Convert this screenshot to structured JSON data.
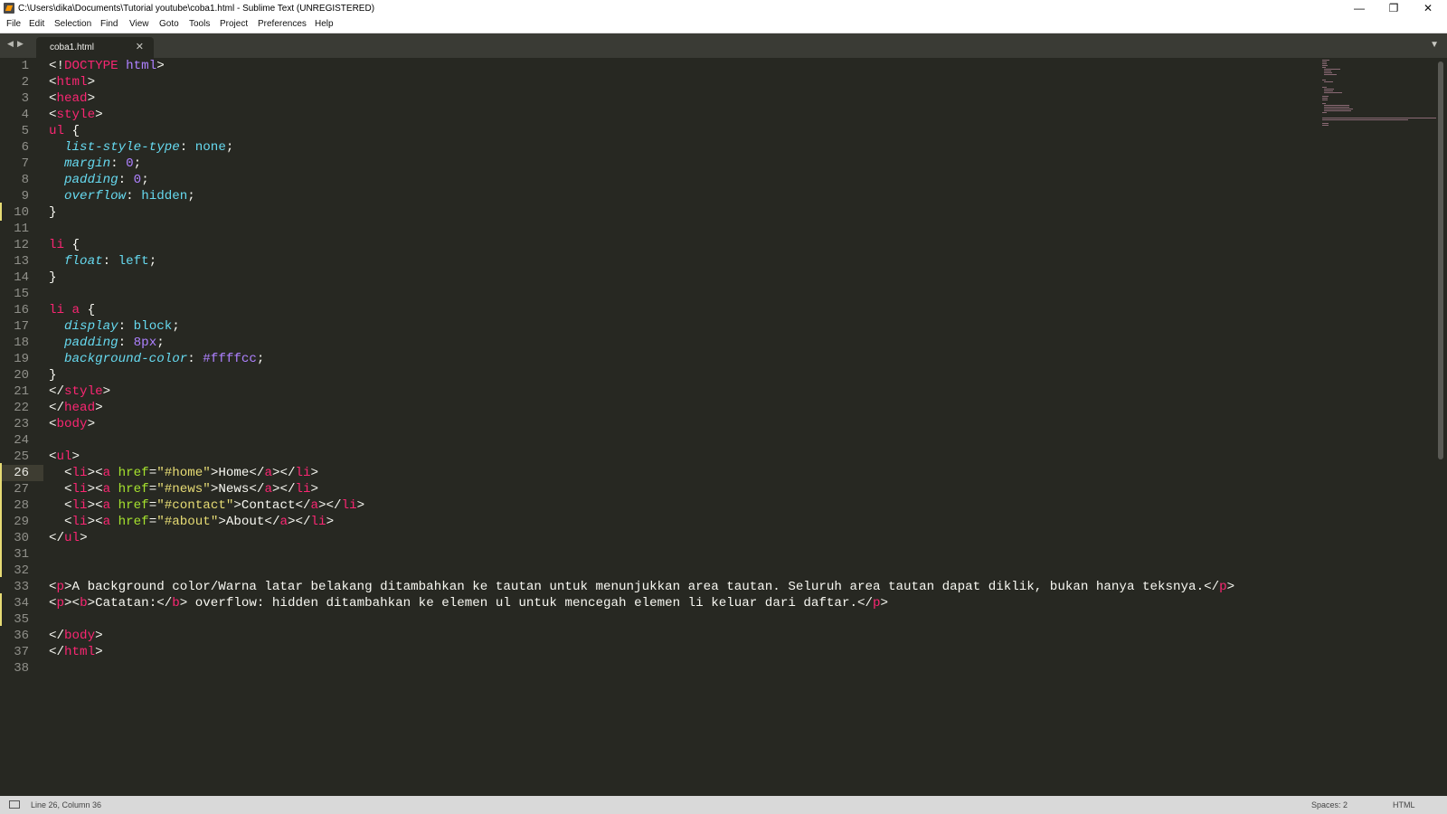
{
  "window": {
    "title": "C:\\Users\\dika\\Documents\\Tutorial youtube\\coba1.html - Sublime Text (UNREGISTERED)",
    "minimize_glyph": "—",
    "restore_glyph": "❐",
    "close_glyph": "✕"
  },
  "menu": [
    "File",
    "Edit",
    "Selection",
    "Find",
    "View",
    "Goto",
    "Tools",
    "Project",
    "Preferences",
    "Help"
  ],
  "tabs": {
    "back_glyph": "◀",
    "forward_glyph": "▶",
    "active_tab": "coba1.html",
    "close_glyph": "✕",
    "dropdown_glyph": "▼"
  },
  "editor": {
    "current_line": 26,
    "line_numbers": [
      "1",
      "2",
      "3",
      "4",
      "5",
      "6",
      "7",
      "8",
      "9",
      "10",
      "11",
      "12",
      "13",
      "14",
      "15",
      "16",
      "17",
      "18",
      "19",
      "20",
      "21",
      "22",
      "23",
      "24",
      "25",
      "26",
      "27",
      "28",
      "29",
      "30",
      "31",
      "32",
      "33",
      "34",
      "35",
      "36",
      "37",
      "38"
    ],
    "lines": [
      [
        [
          "p",
          "<!"
        ],
        [
          "doctype",
          "DOCTYPE"
        ],
        [
          "p",
          " "
        ],
        [
          "dtval",
          "html"
        ],
        [
          "p",
          ">"
        ]
      ],
      [
        [
          "p",
          "<"
        ],
        [
          "tag",
          "html"
        ],
        [
          "p",
          ">"
        ]
      ],
      [
        [
          "p",
          "<"
        ],
        [
          "tag",
          "head"
        ],
        [
          "p",
          ">"
        ]
      ],
      [
        [
          "p",
          "<"
        ],
        [
          "tag",
          "style"
        ],
        [
          "p",
          ">"
        ]
      ],
      [
        [
          "tag",
          "ul"
        ],
        [
          "p",
          " {"
        ]
      ],
      [
        [
          "p",
          "  "
        ],
        [
          "prop",
          "list-style-type"
        ],
        [
          "p",
          ": "
        ],
        [
          "sup",
          "none"
        ],
        [
          "p",
          ";"
        ]
      ],
      [
        [
          "p",
          "  "
        ],
        [
          "prop",
          "margin"
        ],
        [
          "p",
          ": "
        ],
        [
          "num",
          "0"
        ],
        [
          "p",
          ";"
        ]
      ],
      [
        [
          "p",
          "  "
        ],
        [
          "prop",
          "padding"
        ],
        [
          "p",
          ": "
        ],
        [
          "num",
          "0"
        ],
        [
          "p",
          ";"
        ]
      ],
      [
        [
          "p",
          "  "
        ],
        [
          "prop",
          "overflow"
        ],
        [
          "p",
          ": "
        ],
        [
          "sup",
          "hidden"
        ],
        [
          "p",
          ";"
        ]
      ],
      [
        [
          "p",
          "}"
        ]
      ],
      [],
      [
        [
          "tag",
          "li"
        ],
        [
          "p",
          " {"
        ]
      ],
      [
        [
          "p",
          "  "
        ],
        [
          "prop",
          "float"
        ],
        [
          "p",
          ": "
        ],
        [
          "sup",
          "left"
        ],
        [
          "p",
          ";"
        ]
      ],
      [
        [
          "p",
          "}"
        ]
      ],
      [],
      [
        [
          "tag",
          "li a"
        ],
        [
          "p",
          " {"
        ]
      ],
      [
        [
          "p",
          "  "
        ],
        [
          "prop",
          "display"
        ],
        [
          "p",
          ": "
        ],
        [
          "sup",
          "block"
        ],
        [
          "p",
          ";"
        ]
      ],
      [
        [
          "p",
          "  "
        ],
        [
          "prop",
          "padding"
        ],
        [
          "p",
          ": "
        ],
        [
          "num",
          "8px"
        ],
        [
          "p",
          ";"
        ]
      ],
      [
        [
          "p",
          "  "
        ],
        [
          "prop",
          "background-color"
        ],
        [
          "p",
          ": "
        ],
        [
          "num",
          "#ffffcc"
        ],
        [
          "p",
          ";"
        ]
      ],
      [
        [
          "p",
          "}"
        ]
      ],
      [
        [
          "p",
          "</"
        ],
        [
          "tag",
          "style"
        ],
        [
          "p",
          ">"
        ]
      ],
      [
        [
          "p",
          "</"
        ],
        [
          "tag",
          "head"
        ],
        [
          "p",
          ">"
        ]
      ],
      [
        [
          "p",
          "<"
        ],
        [
          "tag",
          "body"
        ],
        [
          "p",
          ">"
        ]
      ],
      [],
      [
        [
          "p",
          "<"
        ],
        [
          "tag",
          "ul"
        ],
        [
          "p",
          ">"
        ]
      ],
      [
        [
          "p",
          "  <"
        ],
        [
          "tag",
          "li"
        ],
        [
          "p",
          "><"
        ],
        [
          "tag",
          "a"
        ],
        [
          "p",
          " "
        ],
        [
          "attr",
          "href"
        ],
        [
          "p",
          "="
        ],
        [
          "str",
          "\"#home\""
        ],
        [
          "p",
          ">Home</"
        ],
        [
          "tag",
          "a"
        ],
        [
          "p",
          "></"
        ],
        [
          "tag",
          "li"
        ],
        [
          "p",
          ">"
        ]
      ],
      [
        [
          "p",
          "  <"
        ],
        [
          "tag",
          "li"
        ],
        [
          "p",
          "><"
        ],
        [
          "tag",
          "a"
        ],
        [
          "p",
          " "
        ],
        [
          "attr",
          "href"
        ],
        [
          "p",
          "="
        ],
        [
          "str",
          "\"#news\""
        ],
        [
          "p",
          ">News</"
        ],
        [
          "tag",
          "a"
        ],
        [
          "p",
          "></"
        ],
        [
          "tag",
          "li"
        ],
        [
          "p",
          ">"
        ]
      ],
      [
        [
          "p",
          "  <"
        ],
        [
          "tag",
          "li"
        ],
        [
          "p",
          "><"
        ],
        [
          "tag",
          "a"
        ],
        [
          "p",
          " "
        ],
        [
          "attr",
          "href"
        ],
        [
          "p",
          "="
        ],
        [
          "str",
          "\"#contact\""
        ],
        [
          "p",
          ">Contact</"
        ],
        [
          "tag",
          "a"
        ],
        [
          "p",
          "></"
        ],
        [
          "tag",
          "li"
        ],
        [
          "p",
          ">"
        ]
      ],
      [
        [
          "p",
          "  <"
        ],
        [
          "tag",
          "li"
        ],
        [
          "p",
          "><"
        ],
        [
          "tag",
          "a"
        ],
        [
          "p",
          " "
        ],
        [
          "attr",
          "href"
        ],
        [
          "p",
          "="
        ],
        [
          "str",
          "\"#about\""
        ],
        [
          "p",
          ">About</"
        ],
        [
          "tag",
          "a"
        ],
        [
          "p",
          "></"
        ],
        [
          "tag",
          "li"
        ],
        [
          "p",
          ">"
        ]
      ],
      [
        [
          "p",
          "</"
        ],
        [
          "tag",
          "ul"
        ],
        [
          "p",
          ">"
        ]
      ],
      [],
      [],
      [
        [
          "p",
          "<"
        ],
        [
          "tag",
          "p"
        ],
        [
          "p",
          ">A background color/Warna latar belakang ditambahkan ke tautan untuk menunjukkan area tautan. Seluruh area tautan dapat diklik, bukan hanya teksnya.</"
        ],
        [
          "tag",
          "p"
        ],
        [
          "p",
          ">"
        ]
      ],
      [
        [
          "p",
          "<"
        ],
        [
          "tag",
          "p"
        ],
        [
          "p",
          "><"
        ],
        [
          "tag",
          "b"
        ],
        [
          "p",
          ">Catatan:</"
        ],
        [
          "tag",
          "b"
        ],
        [
          "p",
          "> overflow: hidden ditambahkan ke elemen ul untuk mencegah elemen li keluar dari daftar.</"
        ],
        [
          "tag",
          "p"
        ],
        [
          "p",
          ">"
        ]
      ],
      [],
      [
        [
          "p",
          "</"
        ],
        [
          "tag",
          "body"
        ],
        [
          "p",
          ">"
        ]
      ],
      [
        [
          "p",
          "</"
        ],
        [
          "tag",
          "html"
        ],
        [
          "p",
          ">"
        ]
      ],
      []
    ]
  },
  "status": {
    "position": "Line 26, Column 36",
    "indent": "Spaces: 2",
    "syntax": "HTML"
  },
  "colors": {
    "background": "#272822",
    "tag": "#f92672",
    "attribute": "#a6e22e",
    "string": "#e6db74",
    "property": "#66d9ef",
    "number": "#ae81ff"
  }
}
